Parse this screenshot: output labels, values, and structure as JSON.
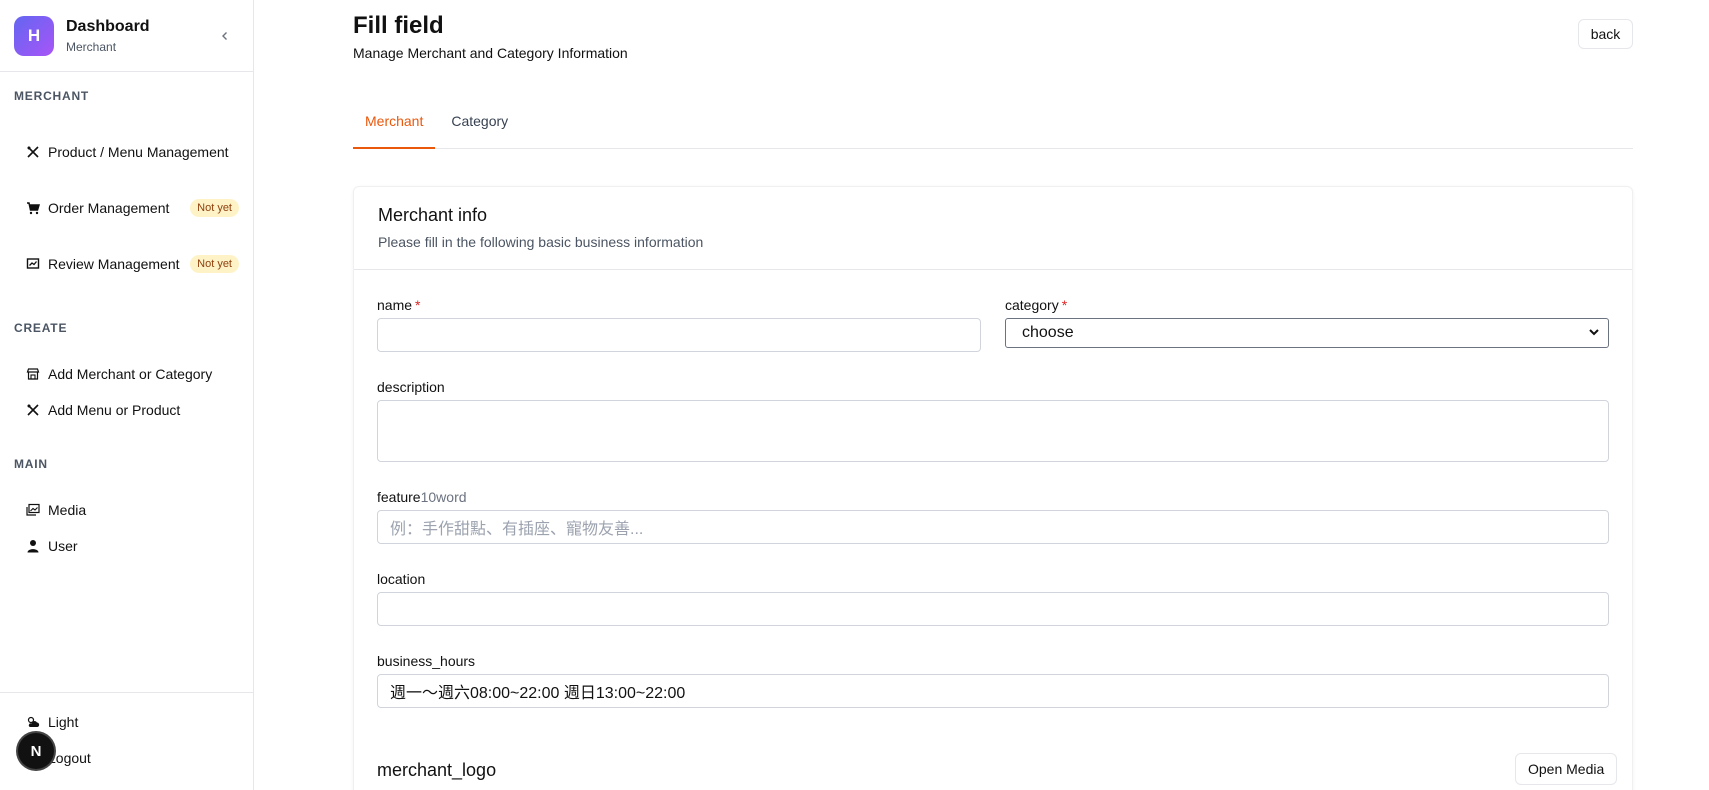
{
  "brand": {
    "logo_letter": "H",
    "title": "Dashboard",
    "subtitle": "Merchant"
  },
  "sidebar": {
    "sections": [
      {
        "label": "MERCHANT"
      },
      {
        "label": "CREATE"
      },
      {
        "label": "MAIN"
      }
    ],
    "merchant_items": [
      {
        "label": "Product / Menu Management",
        "icon": "utensils-icon"
      },
      {
        "label": "Order Management",
        "icon": "cart-icon",
        "badge": "Not yet"
      },
      {
        "label": "Review Management",
        "icon": "review-icon",
        "badge": "Not yet"
      }
    ],
    "create_items": [
      {
        "label": "Add Merchant or Category",
        "icon": "store-icon"
      },
      {
        "label": "Add Menu or Product",
        "icon": "utensils-icon"
      }
    ],
    "main_items": [
      {
        "label": "Media",
        "icon": "images-icon"
      },
      {
        "label": "User",
        "icon": "user-icon"
      }
    ],
    "bottom_items": [
      {
        "label": "Light",
        "icon": "weather-icon"
      },
      {
        "label": "Logout",
        "icon": "logout-icon"
      }
    ],
    "avatar_letter": "N"
  },
  "header": {
    "title": "Fill field",
    "subtitle": "Manage Merchant and Category Information",
    "back_label": "back"
  },
  "tabs": [
    {
      "label": "Merchant",
      "active": true
    },
    {
      "label": "Category",
      "active": false
    }
  ],
  "card": {
    "title": "Merchant info",
    "description": "Please fill in the following basic business information"
  },
  "form": {
    "name": {
      "label": "name",
      "required": "*",
      "value": ""
    },
    "category": {
      "label": "category",
      "required": "*",
      "selected": "choose"
    },
    "description": {
      "label": "description",
      "value": ""
    },
    "feature": {
      "label": "feature",
      "hint": "10word",
      "placeholder": "例：手作甜點、有插座、寵物友善..."
    },
    "location": {
      "label": "location",
      "value": ""
    },
    "business_hours": {
      "label": "business_hours",
      "value": "週一～週六08:00~22:00 週日13:00~22:00"
    },
    "merchant_logo": {
      "label": "merchant_logo",
      "button_label": "Open Media"
    }
  },
  "colors": {
    "accent": "#ea580c",
    "brand_gradient_start": "#6366f1",
    "brand_gradient_end": "#a855f7",
    "badge_bg": "#fef3c7",
    "required": "#dc2626"
  }
}
